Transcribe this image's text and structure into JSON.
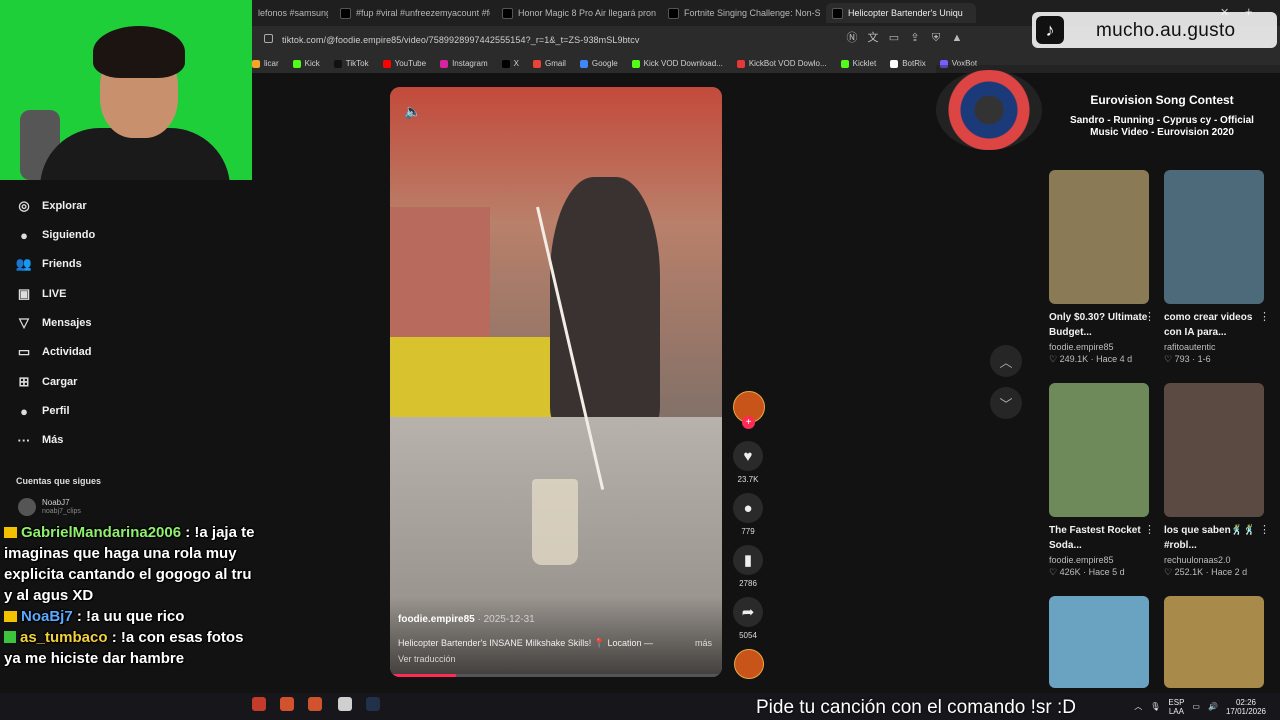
{
  "browser": {
    "tabs": [
      {
        "label": "lefonos #samsung"
      },
      {
        "label": "#fup #viral #unfreezemyacount #for"
      },
      {
        "label": "Honor Magic 8 Pro Air llegará pronto"
      },
      {
        "label": "Fortnite Singing Challenge: Non-Sto"
      },
      {
        "label": "Helicopter Bartender's Uniqu"
      }
    ],
    "url": "tiktok.com/@foodie.empire85/video/7589928997442555154?_r=1&_t=ZS-938mSL9btcv",
    "bookmarks": [
      {
        "label": "licar",
        "color": "#f5a623"
      },
      {
        "label": "Kick",
        "color": "#53fc18"
      },
      {
        "label": "TikTok",
        "color": "#111111"
      },
      {
        "label": "YouTube",
        "color": "#ff0000"
      },
      {
        "label": "Instagram",
        "color": "#d6249f"
      },
      {
        "label": "X",
        "color": "#000000"
      },
      {
        "label": "Gmail",
        "color": "#ea4335"
      },
      {
        "label": "Google",
        "color": "#4285f4"
      },
      {
        "label": "Kick VOD Download...",
        "color": "#53fc18"
      },
      {
        "label": "KickBot VOD Dowlo...",
        "color": "#e53935"
      },
      {
        "label": "Kicklet",
        "color": "#53fc18"
      },
      {
        "label": "BotRix",
        "color": "#ffffff"
      },
      {
        "label": "VoxBot",
        "color": "#7b5cff"
      }
    ]
  },
  "sidebar": {
    "items": [
      {
        "label": "Explorar",
        "icon": "compass-icon",
        "glyph": "◎"
      },
      {
        "label": "Siguiendo",
        "icon": "following-icon",
        "glyph": "●"
      },
      {
        "label": "Friends",
        "icon": "friends-icon",
        "glyph": "👥"
      },
      {
        "label": "LIVE",
        "icon": "live-icon",
        "glyph": "▣"
      },
      {
        "label": "Mensajes",
        "icon": "messages-icon",
        "glyph": "▽"
      },
      {
        "label": "Actividad",
        "icon": "activity-icon",
        "glyph": "▭"
      },
      {
        "label": "Cargar",
        "icon": "upload-icon",
        "glyph": "⊞"
      },
      {
        "label": "Perfil",
        "icon": "profile-icon",
        "glyph": "●"
      },
      {
        "label": "Más",
        "icon": "more-icon",
        "glyph": "···"
      }
    ],
    "following_title": "Cuentas que sigues",
    "following": [
      {
        "name": "NoabJ7",
        "handle": "noabj7_clips"
      }
    ]
  },
  "chat": {
    "messages": [
      {
        "user": "GabrielMandarina2006",
        "text": ": !a jaja te imaginas que haga una rola muy explicita cantando el gogogo al tru y al agus XD"
      },
      {
        "user": "NoaBj7",
        "text": ": !a uu que rico"
      },
      {
        "user": "as_tumbaco",
        "text": ": !a con esas fotos ya me hiciste dar hambre"
      }
    ]
  },
  "video": {
    "author": "foodie.empire85",
    "date": " · 2025-12-31",
    "description": "Helicopter Bartender's INSANE Milkshake Skills! 📍 Location —",
    "more": "más",
    "translate": "Ver traducción",
    "progress": 0.2,
    "likes": "23.7K",
    "comments": "779",
    "saves": "2786",
    "shares": "5054"
  },
  "song_overlay": {
    "channel": "mucho.au.gusto",
    "title": "Eurovision Song Contest",
    "subtitle": "Sandro - Running - Cyprus cy - Official Music Video - Eurovision 2020"
  },
  "recommended": [
    {
      "title": "Only $0.30? Ultimate Budget...",
      "author": "foodie.empire85",
      "meta": "♡ 249.1K · Hace 4 d",
      "color": "#8a7a55"
    },
    {
      "title": "como crear videos con IA para...",
      "author": "rafitoautentic",
      "meta": "♡ 793 · 1-6",
      "color": "#4d6a7a"
    },
    {
      "title": "The Fastest Rocket Soda...",
      "author": "foodie.empire85",
      "meta": "♡ 426K · Hace 5 d",
      "color": "#6f8a5a"
    },
    {
      "title": "los que saben🕺🕺#robl...",
      "author": "rechuulonaas2.0",
      "meta": "♡ 252.1K · Hace 2 d",
      "color": "#5a4a42"
    },
    {
      "title": "",
      "author": "",
      "meta": "",
      "color": "#6aa3c2"
    },
    {
      "title": "",
      "author": "",
      "meta": "",
      "color": "#a88a4a"
    }
  ],
  "request_text": "Pide tu canción con el comando !sr :D",
  "tray": {
    "lang": "ESP",
    "layout": "LAA",
    "time": "02:26",
    "date": "17/01/2026"
  }
}
